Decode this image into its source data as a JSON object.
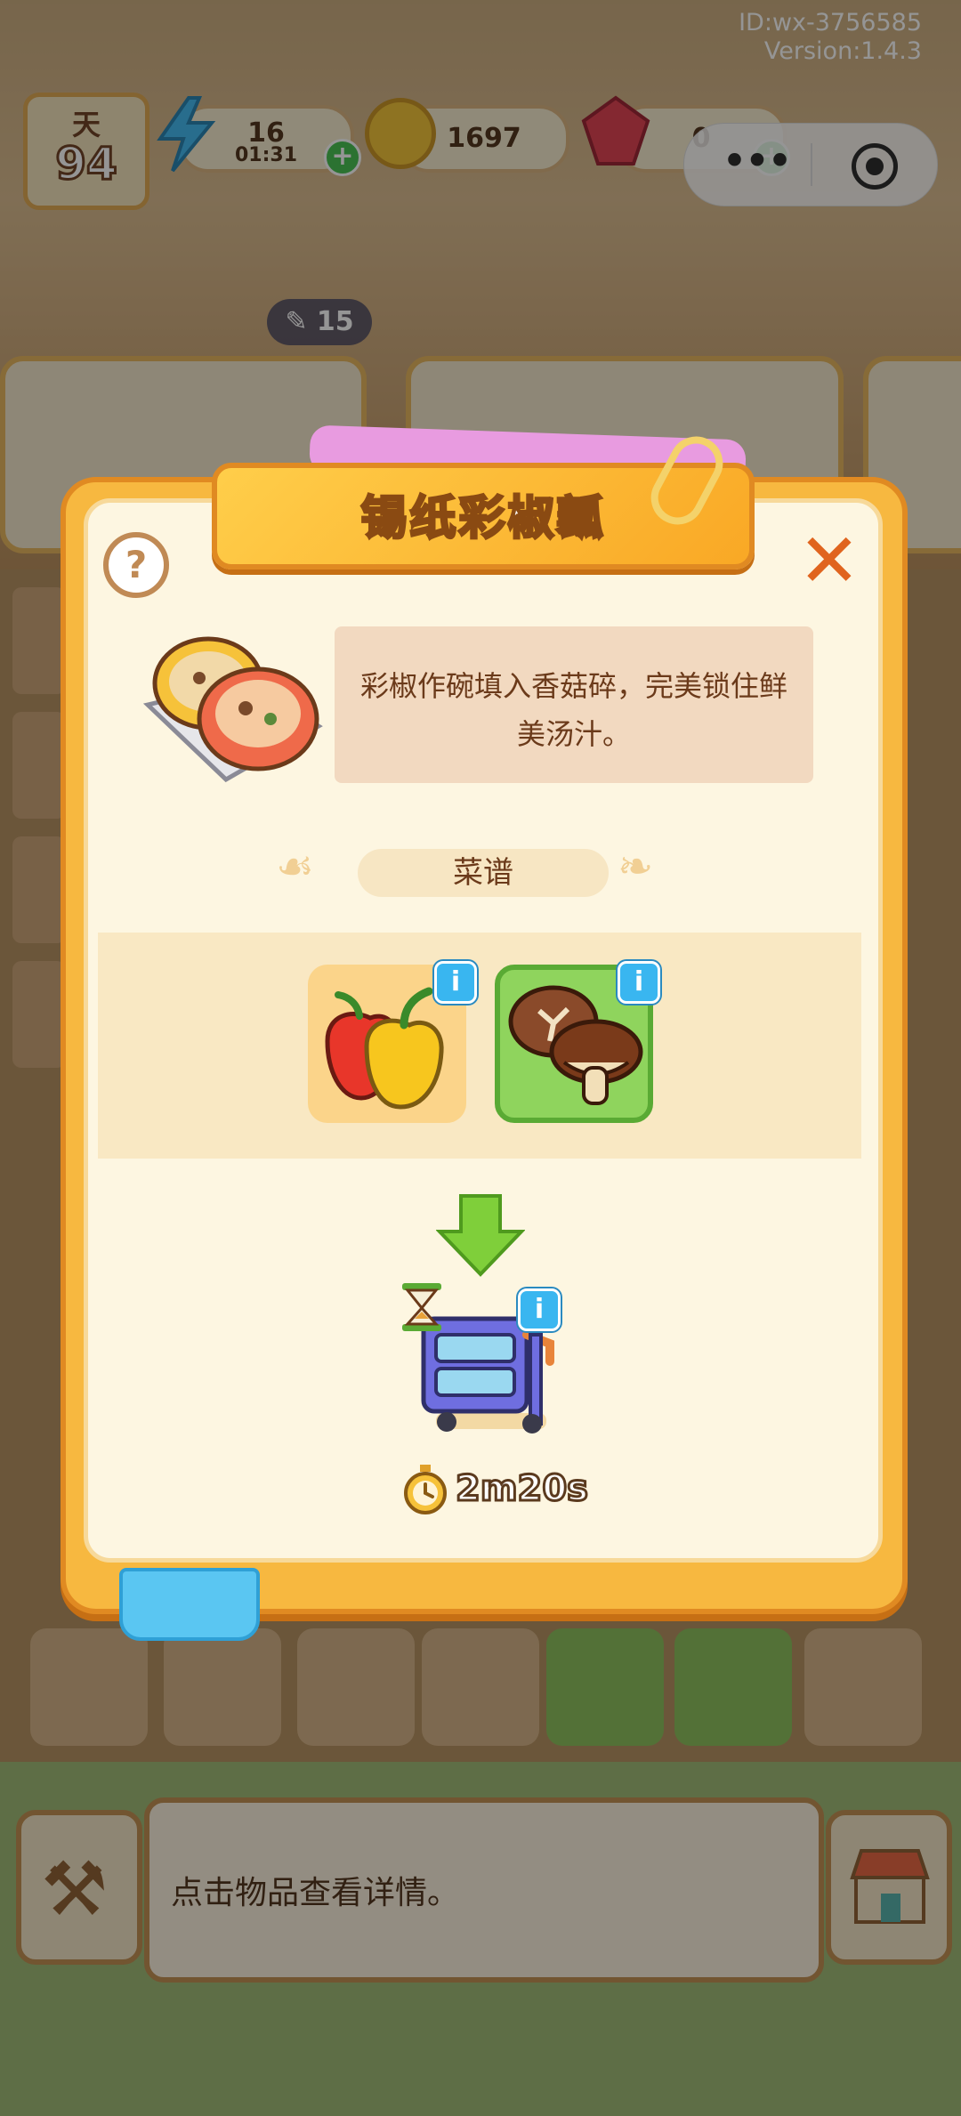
{
  "system": {
    "id": "ID:wx-3756585",
    "version": "Version:1.4.3"
  },
  "hud": {
    "day_label": "天",
    "day_value": "94",
    "energy_value": "16",
    "energy_timer": "01:31",
    "coins_value": "1697",
    "gems_value": "0",
    "side_badge": "15"
  },
  "modal": {
    "title": "锡纸彩椒瓤",
    "description": "彩椒作碗填入香菇碎，完美锁住鲜美汤汁。",
    "recipe_label": "菜谱",
    "ingredients": [
      {
        "name": "bell-pepper-icon"
      },
      {
        "name": "shiitake-mushroom-icon"
      }
    ],
    "cook_time": "2m20s"
  },
  "bottom": {
    "hint": "点击物品查看详情。"
  },
  "colors": {
    "accent": "#f7b840",
    "border": "#e08a22",
    "info": "#39b6f0"
  }
}
